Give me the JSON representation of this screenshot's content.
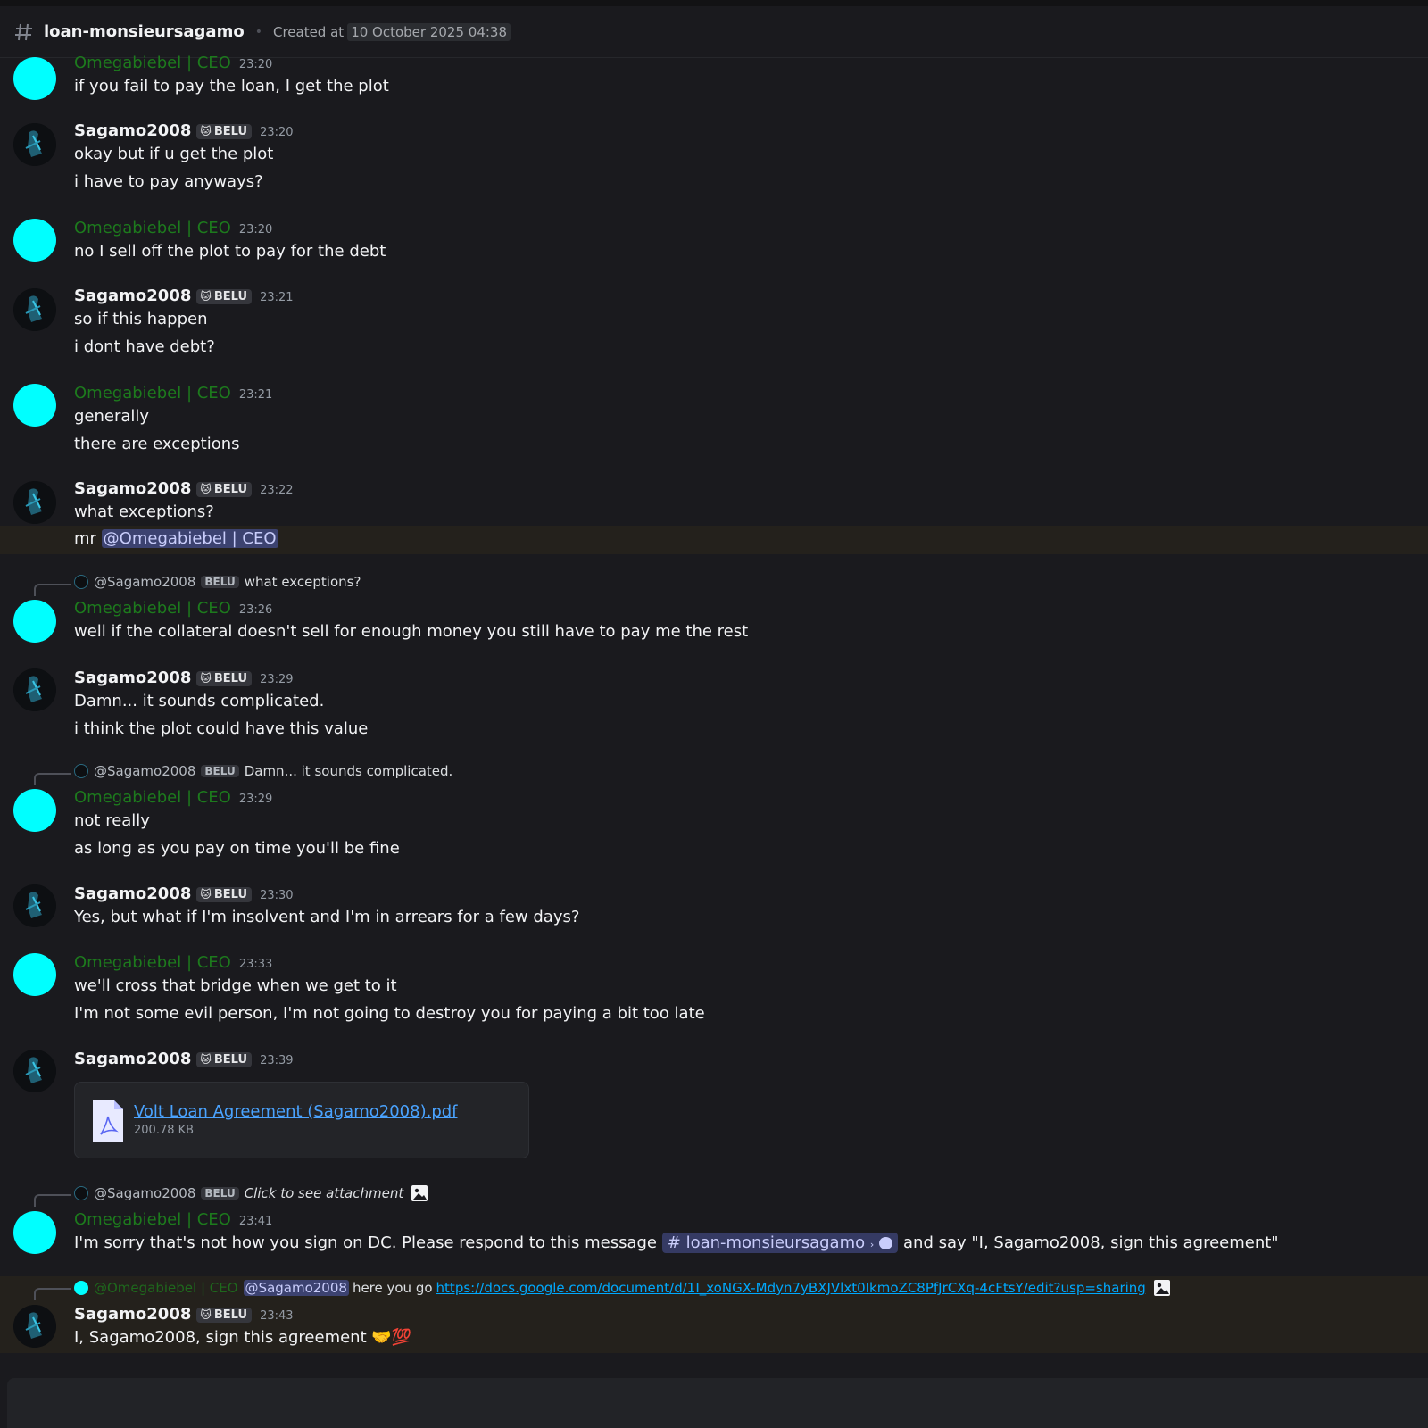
{
  "header": {
    "channel": "loan-monsieursagamo",
    "created_label": "Created at",
    "created_date": "10 October 2025 04:38"
  },
  "users": {
    "omega": "Omegabiebel | CEO",
    "sagamo": "Sagamo2008",
    "tag": "BELU",
    "tag_emoji": "🐱"
  },
  "messages": {
    "m1": {
      "time": "23:20",
      "lines": [
        "if you fail to pay the loan, I get the plot"
      ]
    },
    "m2": {
      "time": "23:20",
      "lines": [
        "okay but if u get the plot",
        "i have to pay anyways?"
      ]
    },
    "m3": {
      "time": "23:20",
      "lines": [
        "no I sell off the plot to pay for the debt"
      ]
    },
    "m4": {
      "time": "23:21",
      "lines": [
        "so if this happen",
        "i dont have debt?"
      ]
    },
    "m5": {
      "time": "23:21",
      "lines": [
        "generally",
        "there are exceptions"
      ]
    },
    "m6": {
      "time": "23:22",
      "lines": [
        "what exceptions?",
        "mr"
      ],
      "mention": "@Omegabiebel | CEO"
    },
    "m7": {
      "reply": {
        "name": "@Sagamo2008",
        "tag": "BELU",
        "text": "what exceptions?"
      },
      "time": "23:26",
      "lines": [
        "well if the collateral doesn't sell for enough money you still have to pay me the rest"
      ]
    },
    "m8": {
      "time": "23:29",
      "lines": [
        "Damn... it sounds complicated.",
        "i think the plot could have this value"
      ]
    },
    "m9": {
      "reply": {
        "name": "@Sagamo2008",
        "tag": "BELU",
        "text": "Damn... it sounds complicated."
      },
      "time": "23:29",
      "lines": [
        "not really",
        "as long as you pay on time you'll be fine"
      ]
    },
    "m10": {
      "time": "23:30",
      "lines": [
        "Yes, but what if I'm insolvent and I'm in arrears for a few days?"
      ]
    },
    "m11": {
      "time": "23:33",
      "lines": [
        "we'll cross that bridge when we get to it",
        "I'm not some evil person, I'm not going to destroy you for paying a bit too late"
      ]
    },
    "m12": {
      "time": "23:39",
      "attachment": {
        "name": "Volt Loan Agreement (Sagamo2008).pdf",
        "size": "200.78 KB"
      }
    },
    "m13": {
      "reply": {
        "name": "@Sagamo2008",
        "tag": "BELU",
        "text": "Click to see attachment"
      },
      "time": "23:41",
      "pre": "I'm sorry that's not how you sign on DC. Please respond to this message",
      "channel_pill": "loan-monsieursagamo",
      "post": "and say \"I, Sagamo2008, sign this agreement\""
    },
    "m14": {
      "reply": {
        "name": "@Omegabiebel | CEO",
        "mention": "@Sagamo2008",
        "text": "here you go",
        "link": "https://docs.google.com/document/d/1I_xoNGX-Mdyn7yBXJVlxt0IkmoZC8PfJrCXq-4cFtsY/edit?usp=sharing"
      },
      "time": "23:43",
      "lines": [
        "I, Sagamo2008, sign this agreement"
      ],
      "emoji": "🤝💯"
    }
  },
  "icons": {
    "channel_hash": "hash-icon",
    "image": "image-icon",
    "file": "pdf-file-icon",
    "thread": "thread-bubble-icon"
  },
  "colors": {
    "background": "#1a1a1e",
    "omega_name": "#1d7a1d",
    "omega_avatar": "#00ffff",
    "link": "#4aa3ff",
    "mention_bg": "#3c4270",
    "highlight_bg": "#24211c"
  }
}
